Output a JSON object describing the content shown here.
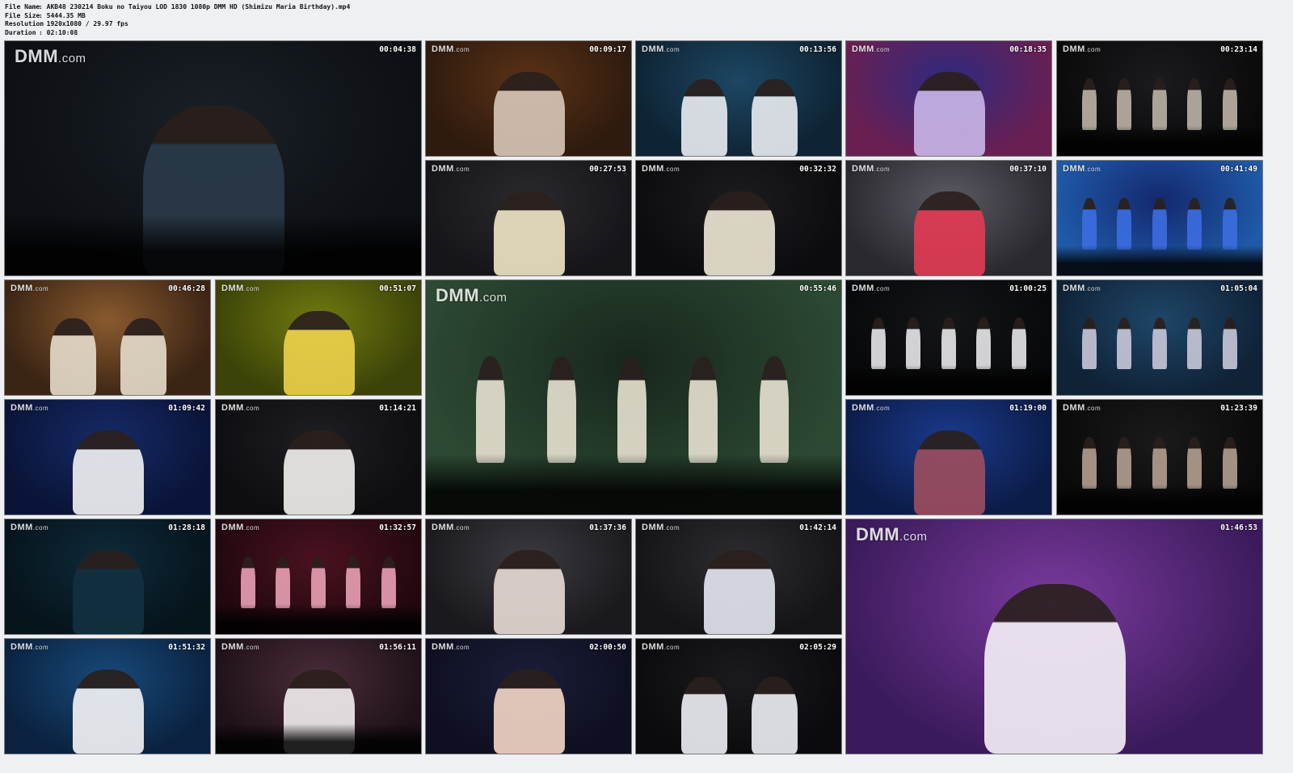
{
  "meta": {
    "rows": [
      {
        "key": "File Name",
        "value": ":  AKB48 230214 Boku no Taiyou LOD 1830 1080p DMM HD (Shimizu Maria Birthday).mp4"
      },
      {
        "key": "File Size",
        "value": ":  5444.35 MB"
      },
      {
        "key": "Resolution",
        "value": ":  1920x1080 / 29.97 fps"
      },
      {
        "key": "Duration",
        "value": ":  02:10:08"
      }
    ]
  },
  "logo": {
    "brand": "DMM",
    "suffix": ".com"
  },
  "frames": [
    {
      "time": "00:04:38",
      "scene": "dark-audience",
      "colors": [
        "#1a2027",
        "#0c0f13",
        "#2a3a4a"
      ]
    },
    {
      "time": "00:09:17",
      "scene": "warm-solo",
      "colors": [
        "#5a3216",
        "#2e1a0e",
        "#d9c7b8"
      ]
    },
    {
      "time": "00:13:56",
      "scene": "blue-trio",
      "colors": [
        "#1d4763",
        "#0e2333",
        "#e9edf1"
      ]
    },
    {
      "time": "00:18:35",
      "scene": "purple-dance",
      "colors": [
        "#2d2a80",
        "#6a1f52",
        "#c9b6e8"
      ]
    },
    {
      "time": "00:23:14",
      "scene": "wide-stage",
      "colors": [
        "#1b1b1e",
        "#0a0a0b",
        "#bdb3a6"
      ]
    },
    {
      "time": "00:27:53",
      "scene": "talk-mc",
      "colors": [
        "#2a2a2e",
        "#15151a",
        "#f1e7c5"
      ]
    },
    {
      "time": "00:32:32",
      "scene": "talk-mc",
      "colors": [
        "#1c1c1f",
        "#0c0c0e",
        "#efe8d6"
      ]
    },
    {
      "time": "00:37:10",
      "scene": "red-solo",
      "colors": [
        "#5b5a62",
        "#2a2930",
        "#e43a54"
      ]
    },
    {
      "time": "00:41:49",
      "scene": "blue-group",
      "colors": [
        "#14286e",
        "#1f5aa8",
        "#3c6de0"
      ]
    },
    {
      "time": "00:46:28",
      "scene": "warm-duo",
      "colors": [
        "#8a5a2e",
        "#3a2414",
        "#e6dccb"
      ]
    },
    {
      "time": "00:51:07",
      "scene": "yellow-solo",
      "colors": [
        "#6f7a10",
        "#3c4208",
        "#f0d24a"
      ]
    },
    {
      "time": "00:55:46",
      "scene": "green-wide",
      "colors": [
        "#18261d",
        "#2c4a33",
        "#e8e2d2"
      ]
    },
    {
      "time": "01:00:25",
      "scene": "wide-stage",
      "colors": [
        "#141517",
        "#08090a",
        "#e7e7ea"
      ]
    },
    {
      "time": "01:05:04",
      "scene": "blue-line",
      "colors": [
        "#1f4668",
        "#0f2236",
        "#c8c8d8"
      ]
    },
    {
      "time": "01:09:42",
      "scene": "blue-solo",
      "colors": [
        "#162a66",
        "#0a1438",
        "#f3f3f5"
      ]
    },
    {
      "time": "01:14:21",
      "scene": "dark-solo",
      "colors": [
        "#1e1e23",
        "#0e0e10",
        "#f4f1ee"
      ]
    },
    {
      "time": "01:19:00",
      "scene": "blue-solo",
      "colors": [
        "#1a3a8c",
        "#0c1c48",
        "#9e4d5e"
      ]
    },
    {
      "time": "01:23:39",
      "scene": "wide-stage",
      "colors": [
        "#1a1a1a",
        "#0a0a0a",
        "#b39f90"
      ]
    },
    {
      "time": "01:28:18",
      "scene": "curtain",
      "colors": [
        "#0e2a3a",
        "#06141c",
        "#123042"
      ]
    },
    {
      "time": "01:32:57",
      "scene": "red-group",
      "colors": [
        "#4a1220",
        "#22080e",
        "#e9a0b4"
      ]
    },
    {
      "time": "01:37:36",
      "scene": "talk-mc",
      "colors": [
        "#3a3a40",
        "#1a1a1e",
        "#e9dcd6"
      ]
    },
    {
      "time": "01:42:14",
      "scene": "talk-mc",
      "colors": [
        "#2c2c31",
        "#141418",
        "#e6e8f2"
      ]
    },
    {
      "time": "01:46:53",
      "scene": "purple-solo",
      "colors": [
        "#7a3a9e",
        "#3a1a5a",
        "#f6f2f8"
      ]
    },
    {
      "time": "01:51:32",
      "scene": "blue-singer",
      "colors": [
        "#184a7a",
        "#0a2240",
        "#f5f5f7"
      ]
    },
    {
      "time": "01:56:11",
      "scene": "cake",
      "colors": [
        "#4a2b3a",
        "#1e1118",
        "#f3eef0"
      ]
    },
    {
      "time": "02:00:50",
      "scene": "closeup",
      "colors": [
        "#1c1e3a",
        "#0e0f20",
        "#f5d7c7"
      ]
    },
    {
      "time": "02:05:29",
      "scene": "talk-pair",
      "colors": [
        "#1b1b1f",
        "#0b0b0d",
        "#eef0f6"
      ]
    }
  ]
}
